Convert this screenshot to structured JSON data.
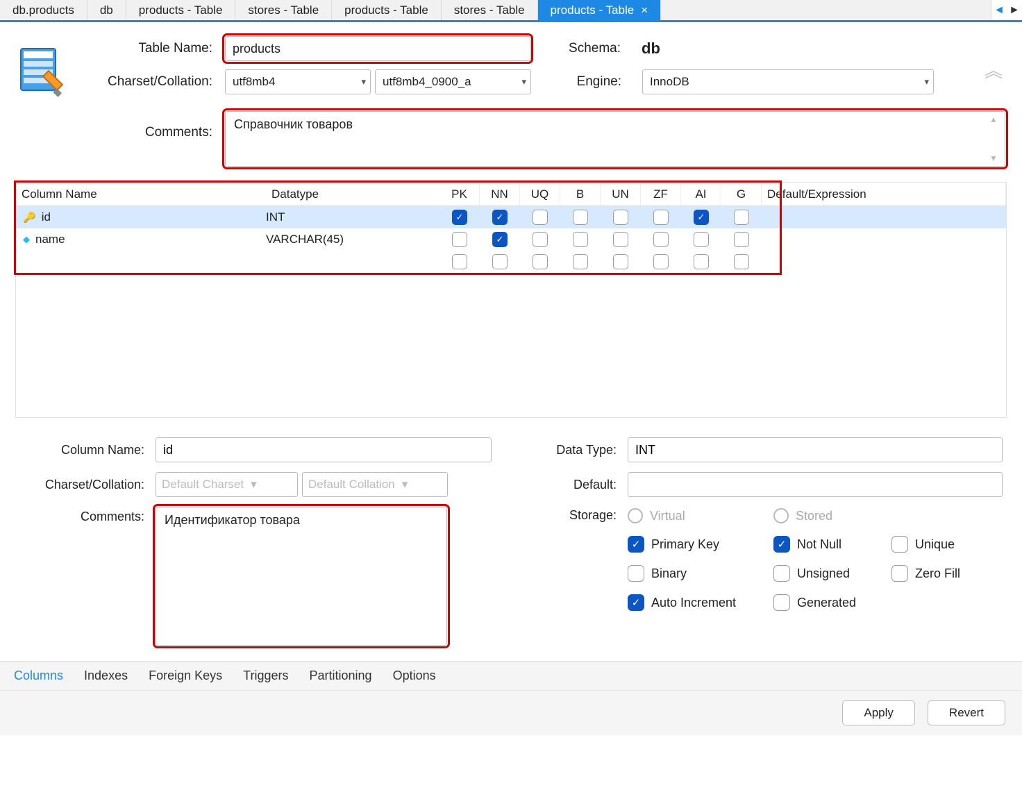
{
  "tabs": [
    {
      "label": "db.products"
    },
    {
      "label": "db"
    },
    {
      "label": "products - Table"
    },
    {
      "label": "stores - Table"
    },
    {
      "label": "products - Table"
    },
    {
      "label": "stores - Table"
    },
    {
      "label": "products - Table",
      "active": true
    }
  ],
  "header": {
    "table_name_label": "Table Name:",
    "table_name": "products",
    "schema_label": "Schema:",
    "schema": "db",
    "charset_label": "Charset/Collation:",
    "charset": "utf8mb4",
    "collation": "utf8mb4_0900_a",
    "engine_label": "Engine:",
    "engine": "InnoDB",
    "comments_label": "Comments:",
    "comments": "Справочник товаров"
  },
  "grid": {
    "headers": {
      "col_name": "Column Name",
      "datatype": "Datatype",
      "pk": "PK",
      "nn": "NN",
      "uq": "UQ",
      "b": "B",
      "un": "UN",
      "zf": "ZF",
      "ai": "AI",
      "g": "G",
      "expr": "Default/Expression"
    },
    "rows": [
      {
        "icon": "key",
        "name": "id",
        "datatype": "INT",
        "pk": true,
        "nn": true,
        "uq": false,
        "b": false,
        "un": false,
        "zf": false,
        "ai": true,
        "g": false,
        "selected": true,
        "expr": ""
      },
      {
        "icon": "diamond",
        "name": "name",
        "datatype": "VARCHAR(45)",
        "pk": false,
        "nn": true,
        "uq": false,
        "b": false,
        "un": false,
        "zf": false,
        "ai": false,
        "g": false,
        "selected": false,
        "expr": ""
      },
      {
        "icon": "",
        "name": "",
        "datatype": "",
        "pk": false,
        "nn": false,
        "uq": false,
        "b": false,
        "un": false,
        "zf": false,
        "ai": false,
        "g": false,
        "selected": false,
        "blank": true,
        "expr": ""
      }
    ]
  },
  "details": {
    "col_name_label": "Column Name:",
    "col_name": "id",
    "data_type_label": "Data Type:",
    "data_type": "INT",
    "charset_label": "Charset/Collation:",
    "charset_ph": "Default Charset",
    "collation_ph": "Default Collation",
    "default_label": "Default:",
    "default_val": "",
    "comments_label": "Comments:",
    "comments": "Идентификатор товара",
    "storage_label": "Storage:",
    "virtual_label": "Virtual",
    "stored_label": "Stored",
    "pk_label": "Primary Key",
    "nn_label": "Not Null",
    "uq_label": "Unique",
    "b_label": "Binary",
    "un_label": "Unsigned",
    "zf_label": "Zero Fill",
    "ai_label": "Auto Increment",
    "g_label": "Generated",
    "pk": true,
    "nn": true,
    "uq": false,
    "b": false,
    "un": false,
    "zf": false,
    "ai": true,
    "g": false
  },
  "bottom_tabs": [
    "Columns",
    "Indexes",
    "Foreign Keys",
    "Triggers",
    "Partitioning",
    "Options"
  ],
  "bottom_active": 0,
  "footer": {
    "apply": "Apply",
    "revert": "Revert"
  }
}
